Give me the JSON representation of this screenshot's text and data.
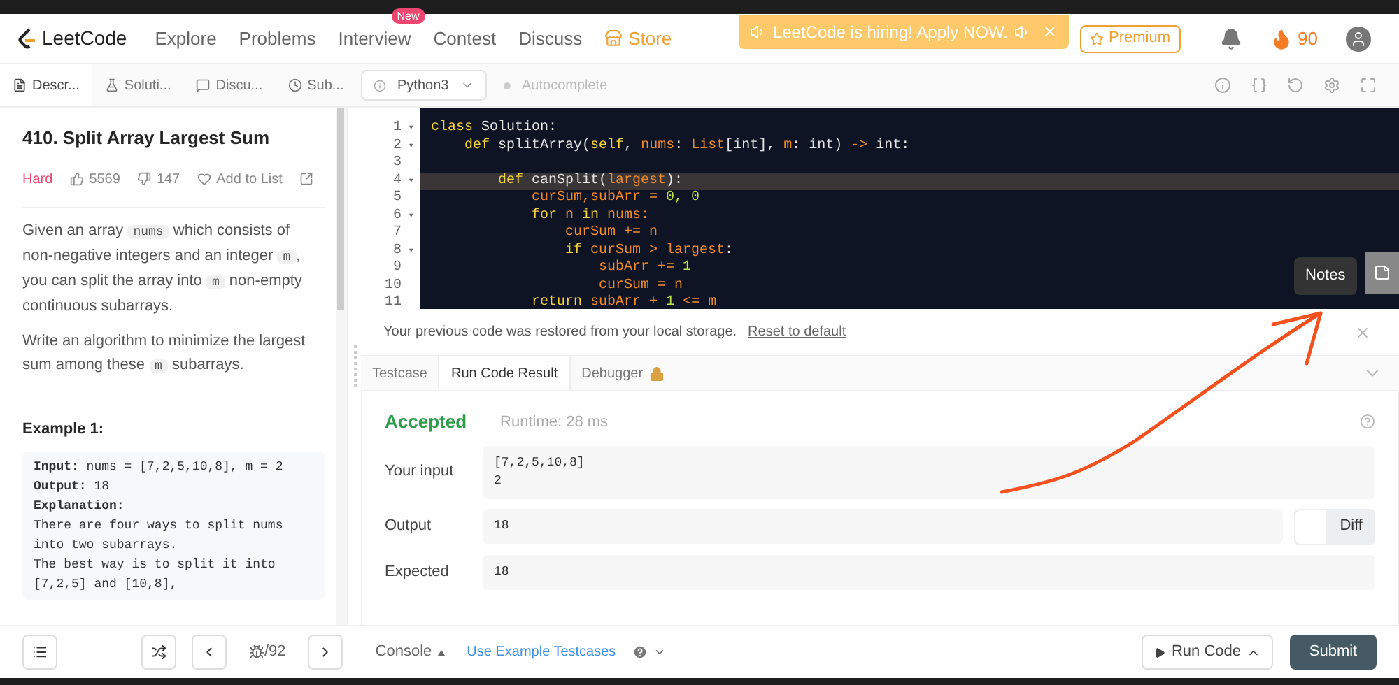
{
  "nav": {
    "logo": "LeetCode",
    "links": [
      {
        "label": "Explore"
      },
      {
        "label": "Problems"
      },
      {
        "label": "Interview",
        "badge": "New"
      },
      {
        "label": "Contest"
      },
      {
        "label": "Discuss"
      }
    ],
    "store": "Store",
    "banner": "LeetCode is hiring! Apply NOW.",
    "premium": "Premium",
    "streak": "90"
  },
  "left_tabs": [
    {
      "label": "Descr...",
      "selected": true
    },
    {
      "label": "Soluti...",
      "selected": false
    },
    {
      "label": "Discu...",
      "selected": false
    },
    {
      "label": "Sub...",
      "selected": false
    }
  ],
  "editor_toolbar": {
    "language": "Python3",
    "autocomplete": "Autocomplete"
  },
  "problem": {
    "title": "410. Split Array Largest Sum",
    "difficulty": "Hard",
    "likes": "5569",
    "dislikes": "147",
    "add_to_list": "Add to List",
    "paragraphs": [
      [
        {
          "text": "Given an array ",
          "kind": "text"
        },
        {
          "text": "nums",
          "kind": "code"
        },
        {
          "text": " which consists of non-negative integers and an integer ",
          "kind": "text"
        },
        {
          "text": "m",
          "kind": "code"
        },
        {
          "text": ", you can split the array into ",
          "kind": "text"
        },
        {
          "text": "m",
          "kind": "code"
        },
        {
          "text": " non-empty continuous subarrays.",
          "kind": "text"
        }
      ],
      [
        {
          "text": "Write an algorithm to minimize the largest sum among these ",
          "kind": "text"
        },
        {
          "text": "m",
          "kind": "code"
        },
        {
          "text": " subarrays.",
          "kind": "text"
        }
      ]
    ],
    "example_title": "Example 1:",
    "example_lines": [
      "**Input:** nums = [7,2,5,10,8], m = 2",
      "**Output:** 18",
      "**Explanation:**",
      "There are four ways to split nums",
      "into two subarrays.",
      "The best way is to split it into",
      "[7,2,5] and [10,8],"
    ]
  },
  "code": [
    {
      "num": "1",
      "fold": "▾",
      "highlighted": false,
      "tokens": [
        {
          "text": "class ",
          "kind": "keyword"
        },
        {
          "text": "Solution:",
          "kind": "plain"
        }
      ]
    },
    {
      "num": "2",
      "fold": "▾",
      "highlighted": false,
      "tokens": [
        {
          "text": "    def ",
          "kind": "keyword"
        },
        {
          "text": "splitArray(",
          "kind": "plain"
        },
        {
          "text": "self",
          "kind": "keyword"
        },
        {
          "text": ", ",
          "kind": "plain"
        },
        {
          "text": "nums",
          "kind": "variable"
        },
        {
          "text": ": ",
          "kind": "plain"
        },
        {
          "text": "List",
          "kind": "variable"
        },
        {
          "text": "[int], ",
          "kind": "plain"
        },
        {
          "text": "m",
          "kind": "variable"
        },
        {
          "text": ": int) ",
          "kind": "plain"
        },
        {
          "text": "->",
          "kind": "variable"
        },
        {
          "text": " int:",
          "kind": "plain"
        }
      ]
    },
    {
      "num": "3",
      "highlighted": false
    },
    {
      "num": "4",
      "fold": "▾",
      "highlighted": true,
      "tokens": [
        {
          "text": "        def ",
          "kind": "keyword"
        },
        {
          "text": "canSplit(",
          "kind": "plain"
        },
        {
          "text": "largest",
          "kind": "variable"
        },
        {
          "text": "):",
          "kind": "plain"
        }
      ]
    },
    {
      "num": "5",
      "highlighted": false,
      "tokens": [
        {
          "text": "            curSum,subArr = ",
          "kind": "variable"
        },
        {
          "text": "0, 0",
          "kind": "number"
        }
      ]
    },
    {
      "num": "6",
      "fold": "▾",
      "highlighted": false,
      "tokens": [
        {
          "text": "            for ",
          "kind": "keyword"
        },
        {
          "text": "n ",
          "kind": "variable"
        },
        {
          "text": "in ",
          "kind": "keyword"
        },
        {
          "text": "nums:",
          "kind": "variable"
        }
      ]
    },
    {
      "num": "7",
      "highlighted": false,
      "tokens": [
        {
          "text": "                curSum += n",
          "kind": "variable"
        }
      ]
    },
    {
      "num": "8",
      "fold": "▾",
      "highlighted": false,
      "tokens": [
        {
          "text": "                if ",
          "kind": "keyword"
        },
        {
          "text": "curSum > largest",
          "kind": "variable"
        },
        {
          "text": ":",
          "kind": "plain"
        }
      ]
    },
    {
      "num": "9",
      "highlighted": false,
      "tokens": [
        {
          "text": "                    subArr += ",
          "kind": "variable"
        },
        {
          "text": "1",
          "kind": "number"
        }
      ]
    },
    {
      "num": "10",
      "highlighted": false,
      "tokens": [
        {
          "text": "                    curSum = n",
          "kind": "variable"
        }
      ]
    },
    {
      "num": "11",
      "highlighted": false,
      "tokens": [
        {
          "text": "            return ",
          "kind": "keyword"
        },
        {
          "text": "subArr + ",
          "kind": "variable"
        },
        {
          "text": "1",
          "kind": "number"
        },
        {
          "text": " <= m",
          "kind": "variable"
        }
      ]
    }
  ],
  "notes_tooltip": "Notes",
  "restore_message": "Your previous code was restored from your local storage.",
  "reset_link": "Reset to default",
  "result_tabs": [
    {
      "label": "Testcase",
      "selected": false,
      "locked": false
    },
    {
      "label": "Run Code Result",
      "selected": true,
      "locked": false
    },
    {
      "label": "Debugger",
      "selected": false,
      "locked": true
    }
  ],
  "result": {
    "status": "Accepted",
    "runtime": "Runtime: 28 ms",
    "rows": [
      {
        "label": "Your input",
        "lines": [
          "[7,2,5,10,8]",
          "2"
        ]
      },
      {
        "label": "Output",
        "lines": [
          "18"
        ],
        "diff": {
          "label": "Diff",
          "on": false
        }
      },
      {
        "label": "Expected",
        "lines": [
          "18"
        ]
      }
    ]
  },
  "bottom": {
    "page": "/92",
    "console": "Console",
    "example_testcases": "Use Example Testcases",
    "run": "Run Code",
    "submit": "Submit"
  }
}
